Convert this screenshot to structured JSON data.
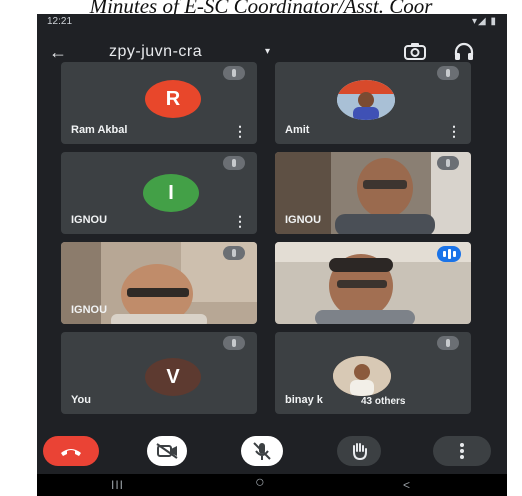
{
  "caption": "Minutes of E-SC Coordinator/Asst. Coor",
  "status": {
    "time": "12:21",
    "system": "▾◢ ▮"
  },
  "meeting": {
    "code": "zpy-juvn-cra",
    "caret": "▾",
    "back": "←"
  },
  "participants": [
    {
      "name": "Ram Akbal",
      "avatar_letter": "R",
      "avatar_color": "#e8472b",
      "state": "muted"
    },
    {
      "name": "Amit",
      "state": "muted",
      "photo": true
    },
    {
      "name": "IGNOU",
      "avatar_letter": "I",
      "avatar_color": "#43a047",
      "state": "muted"
    },
    {
      "name": "IGNOU",
      "state": "muted",
      "video": true
    },
    {
      "name": "IGNOU",
      "state": "muted",
      "video": true
    },
    {
      "name": "",
      "state": "speaking",
      "video": true
    },
    {
      "name": "You",
      "avatar_letter": "V",
      "avatar_color": "#5d3a30",
      "state": "muted"
    },
    {
      "name": "binay k",
      "state": "muted",
      "photo": true,
      "others_label": "43 others"
    }
  ],
  "controls": {
    "leave": "end-call-icon",
    "camera": "camera-off-icon",
    "mic": "mic-off-icon",
    "hand": "raise-hand-icon",
    "more": "more-vert-icon"
  },
  "navbar": {
    "recent": "III",
    "home": "○",
    "back": "<"
  }
}
